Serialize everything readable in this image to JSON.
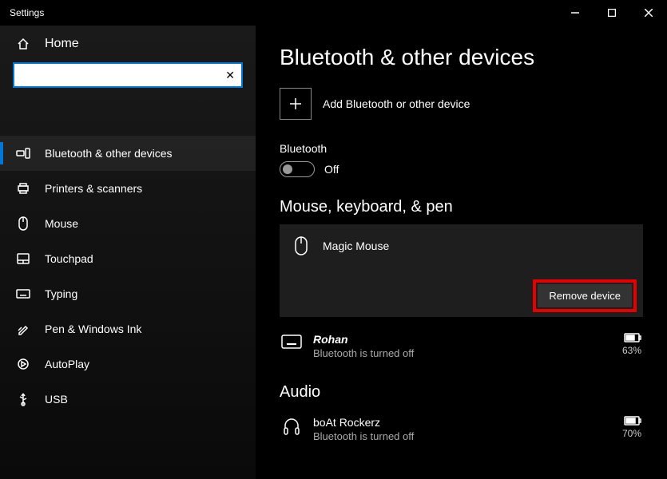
{
  "window": {
    "title": "Settings"
  },
  "sidebar": {
    "home": "Home",
    "search_placeholder": "",
    "items": [
      {
        "label": "Bluetooth & other devices"
      },
      {
        "label": "Printers & scanners"
      },
      {
        "label": "Mouse"
      },
      {
        "label": "Touchpad"
      },
      {
        "label": "Typing"
      },
      {
        "label": "Pen & Windows Ink"
      },
      {
        "label": "AutoPlay"
      },
      {
        "label": "USB"
      }
    ]
  },
  "content": {
    "title": "Bluetooth & other devices",
    "add_label": "Add Bluetooth or other device",
    "bluetooth_label": "Bluetooth",
    "toggle_state": "Off",
    "cat_mouse": "Mouse, keyboard, & pen",
    "device1": {
      "name": "Magic  Mouse",
      "remove": "Remove device"
    },
    "device2": {
      "name": "Rohan",
      "status": "Bluetooth is turned off",
      "battery": "63%"
    },
    "cat_audio": "Audio",
    "device3": {
      "name": "boAt Rockerz",
      "status": "Bluetooth is turned off",
      "battery": "70%"
    }
  }
}
